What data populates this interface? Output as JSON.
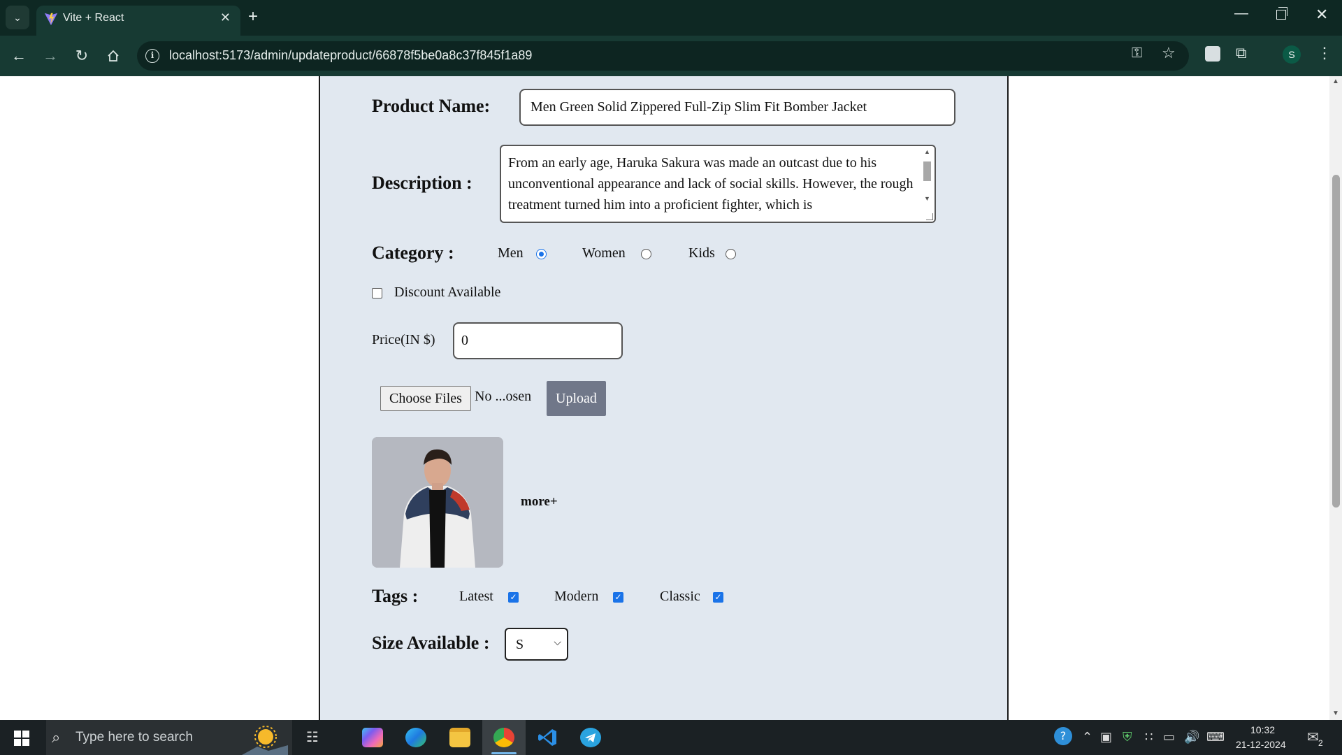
{
  "browser": {
    "tab_title": "Vite + React",
    "url": "localhost:5173/admin/updateproduct/66878f5be0a8c37f845f1a89",
    "profile_initial": "S"
  },
  "form": {
    "product_name_label": "Product Name:",
    "product_name_value": "Men Green Solid Zippered Full-Zip Slim Fit Bomber Jacket",
    "description_label": "Description :",
    "description_value": "From an early age, Haruka Sakura was made an outcast due to his unconventional appearance and lack of social skills. However, the rough treatment turned him into a proficient fighter, which is",
    "category_label": "Category :",
    "categories": [
      {
        "label": "Men",
        "selected": true
      },
      {
        "label": "Women",
        "selected": false
      },
      {
        "label": "Kids",
        "selected": false
      }
    ],
    "discount_label": "Discount Available",
    "discount_checked": false,
    "price_label": "Price(IN $)",
    "price_value": "0",
    "choose_files_label": "Choose Files",
    "no_file_text": "No ...osen",
    "upload_label": "Upload",
    "more_label": "more+",
    "tags_label": "Tags :",
    "tags": [
      {
        "label": "Latest",
        "checked": true
      },
      {
        "label": "Modern",
        "checked": true
      },
      {
        "label": "Classic",
        "checked": true
      }
    ],
    "size_label": "Size Available :",
    "size_value": "S"
  },
  "taskbar": {
    "search_placeholder": "Type here to search",
    "time": "10:32",
    "date": "21-12-2024",
    "notification_count": "2"
  },
  "colors": {
    "chrome_dark": "#0e2823",
    "toolbar": "#173a33",
    "panel_bg": "#e1e8f0",
    "accent": "#1a73e8",
    "upload_button": "#707789"
  }
}
